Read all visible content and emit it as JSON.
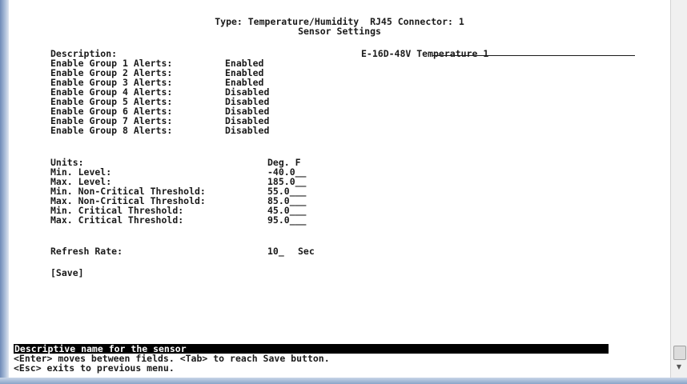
{
  "header": {
    "line1": "Type: Temperature/Humidity  RJ45 Connector: 1",
    "line2": "Sensor Settings"
  },
  "description": {
    "label": "Description:",
    "value": "E-16D-48V Temperature 1"
  },
  "alerts": [
    {
      "label": "Enable Group 1 Alerts:",
      "value": "Enabled"
    },
    {
      "label": "Enable Group 2 Alerts:",
      "value": "Enabled"
    },
    {
      "label": "Enable Group 3 Alerts:",
      "value": "Enabled"
    },
    {
      "label": "Enable Group 4 Alerts:",
      "value": "Disabled"
    },
    {
      "label": "Enable Group 5 Alerts:",
      "value": "Disabled"
    },
    {
      "label": "Enable Group 6 Alerts:",
      "value": "Disabled"
    },
    {
      "label": "Enable Group 7 Alerts:",
      "value": "Disabled"
    },
    {
      "label": "Enable Group 8 Alerts:",
      "value": "Disabled"
    }
  ],
  "settings": [
    {
      "label": "Units:",
      "value": "Deg. F"
    },
    {
      "label": "Min. Level:",
      "value": "-40.0__"
    },
    {
      "label": "Max. Level:",
      "value": "185.0__"
    },
    {
      "label": "Min. Non-Critical Threshold:",
      "value": "55.0___"
    },
    {
      "label": "Max. Non-Critical Threshold:",
      "value": "85.0___"
    },
    {
      "label": "Min. Critical Threshold:",
      "value": "45.0___"
    },
    {
      "label": "Max. Critical Threshold:",
      "value": "95.0___"
    }
  ],
  "refresh": {
    "label": "Refresh Rate:",
    "value": "10_",
    "unit": "Sec"
  },
  "save_label": "[Save]",
  "status_bar": "Descriptive name for the sensor",
  "help": [
    "<Enter> moves between fields. <Tab> to reach Save button.",
    "<Esc> exits to previous menu."
  ]
}
